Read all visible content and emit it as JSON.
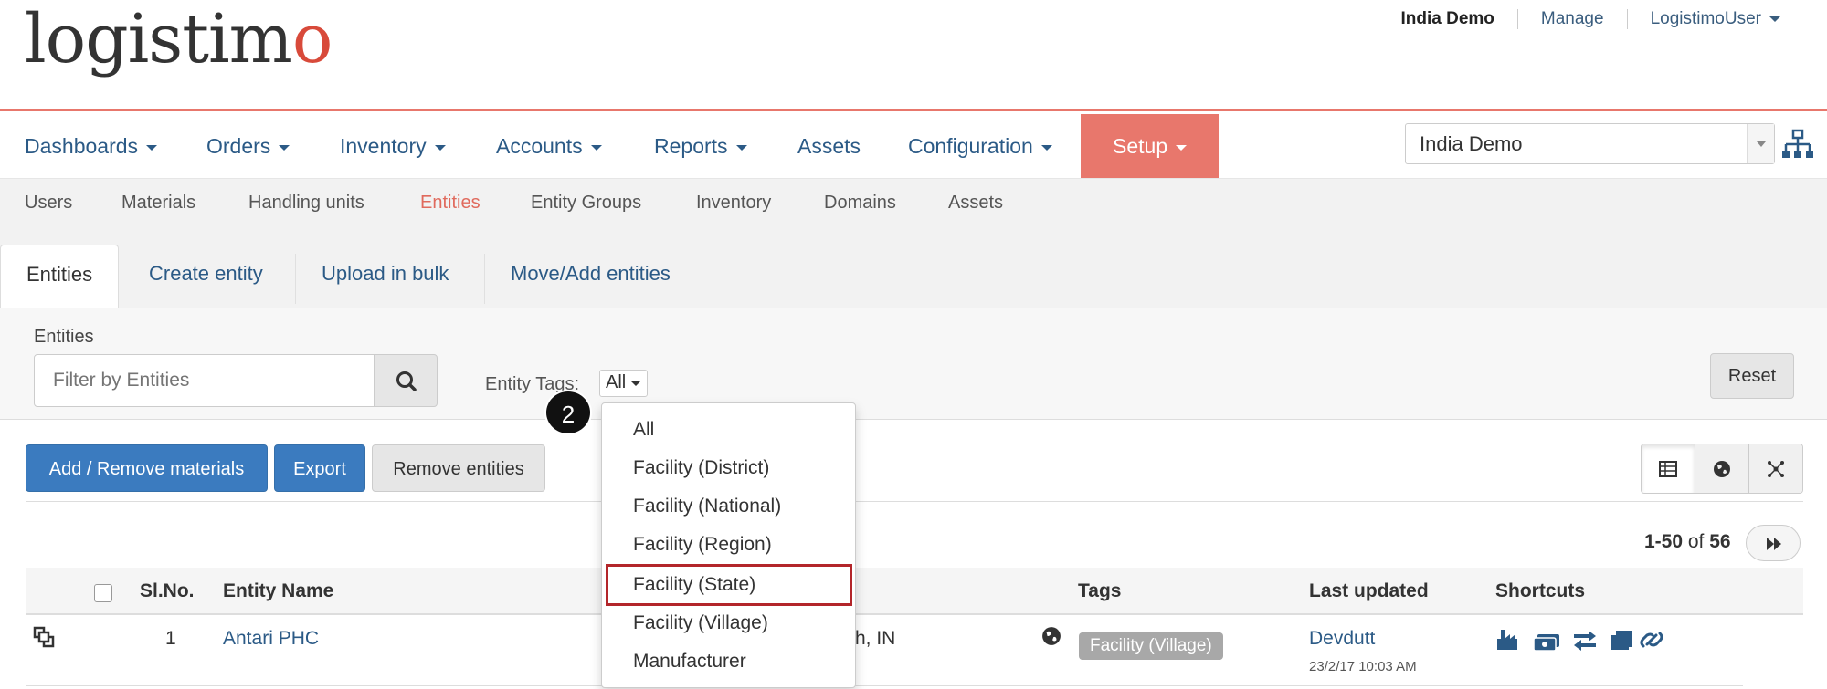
{
  "header": {
    "logo_text_a": "logist",
    "logo_text_b": "i",
    "logo_text_c": "m",
    "logo_text_d": "o",
    "links": [
      "India Demo",
      "Manage",
      "LogistimoUser"
    ]
  },
  "main_nav": {
    "items": [
      "Dashboards",
      "Orders",
      "Inventory",
      "Accounts",
      "Reports",
      "Assets",
      "Configuration",
      "Setup"
    ],
    "active": "Setup",
    "domain_select": "India Demo"
  },
  "sub_nav": {
    "items": [
      "Users",
      "Materials",
      "Handling units",
      "Entities",
      "Entity Groups",
      "Inventory",
      "Domains",
      "Assets"
    ],
    "active": "Entities"
  },
  "tabs": [
    "Entities",
    "Create entity",
    "Upload in bulk",
    "Move/Add entities"
  ],
  "filter": {
    "label": "Entities",
    "placeholder": "Filter by Entities",
    "tags_label": "Entity Tags:",
    "tags_value": "All",
    "reset_label": "Reset"
  },
  "actions": {
    "add_remove": "Add / Remove materials",
    "export": "Export",
    "remove": "Remove entities"
  },
  "pager": {
    "range": "1-50",
    "of": "of",
    "total": "56"
  },
  "table": {
    "headers": [
      "Sl.No.",
      "Entity Name",
      "Tags",
      "Last updated",
      "Shortcuts"
    ],
    "rows": [
      {
        "sl": "1",
        "name": "Antari PHC",
        "location": "h, IN",
        "tag": "Facility (Village)",
        "updated_by": "Devdutt",
        "updated_at": "23/2/17 10:03 AM"
      }
    ]
  },
  "dropdown": {
    "options": [
      "All",
      "Facility (District)",
      "Facility (National)",
      "Facility (Region)",
      "Facility (State)",
      "Facility (Village)",
      "Manufacturer"
    ],
    "highlighted": "Facility (State)"
  },
  "step_badge": "2",
  "colors": {
    "accent": "#e8776c",
    "primary": "#3b7bbf",
    "link": "#2b5a86",
    "highlight": "#b3262a"
  }
}
